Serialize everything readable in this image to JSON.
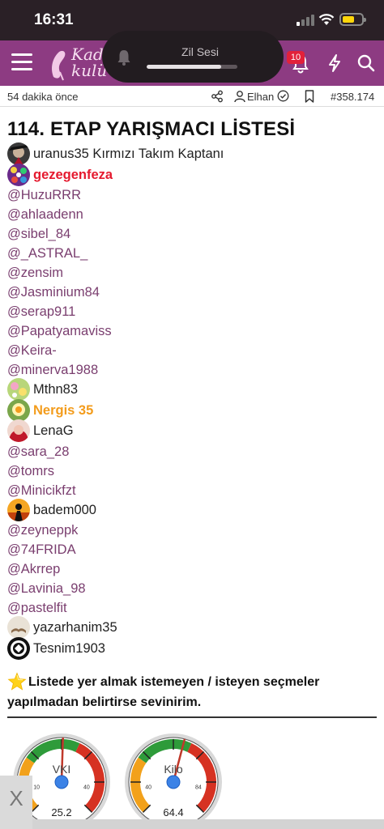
{
  "status": {
    "time": "16:31"
  },
  "island": {
    "label": "Zil Sesi",
    "volume_fraction": 0.82
  },
  "nav": {
    "logo_text": "Kadı\nkulü",
    "notification_count": "10"
  },
  "meta": {
    "time_ago": "54 dakika önce",
    "username": "Elhan",
    "post_number": "#358.174"
  },
  "post": {
    "title": "114. ETAP YARIŞMACI LİSTESİ",
    "entries": [
      {
        "kind": "user",
        "text": "uranus35 Kırmızı Takım Kaptanı",
        "style": "normal",
        "avatar": "dark-hat"
      },
      {
        "kind": "user",
        "text": "gezegenfeza",
        "style": "red",
        "avatar": "colorful-dots"
      },
      {
        "kind": "mention",
        "text": "@HuzuRRR"
      },
      {
        "kind": "mention",
        "text": "@ahlaadenn"
      },
      {
        "kind": "mention",
        "text": "@sibel_84"
      },
      {
        "kind": "mention",
        "text": "@_ASTRAL_"
      },
      {
        "kind": "mention",
        "text": "@zensim"
      },
      {
        "kind": "mention",
        "text": "@Jasminium84"
      },
      {
        "kind": "mention",
        "text": "@serap911"
      },
      {
        "kind": "mention",
        "text": "@Papatyamaviss"
      },
      {
        "kind": "mention",
        "text": "@Keira-"
      },
      {
        "kind": "mention",
        "text": "@minerva1988"
      },
      {
        "kind": "user",
        "text": "Mthn83",
        "style": "normal",
        "avatar": "flowers"
      },
      {
        "kind": "user",
        "text": "Nergis 35",
        "style": "orange",
        "avatar": "daffodil"
      },
      {
        "kind": "user",
        "text": "LenaG",
        "style": "normal",
        "avatar": "red-hair"
      },
      {
        "kind": "mention",
        "text": "@sara_28"
      },
      {
        "kind": "mention",
        "text": "@tomrs"
      },
      {
        "kind": "mention",
        "text": "@Minicikfzt"
      },
      {
        "kind": "user",
        "text": "badem000",
        "style": "normal",
        "avatar": "silhouette"
      },
      {
        "kind": "mention",
        "text": "@zeyneppk"
      },
      {
        "kind": "mention",
        "text": "@74FRIDA"
      },
      {
        "kind": "mention",
        "text": "@Akrrep"
      },
      {
        "kind": "mention",
        "text": "@Lavinia_98"
      },
      {
        "kind": "mention",
        "text": "@pastelfit"
      },
      {
        "kind": "user",
        "text": "yazarhanim35",
        "style": "normal",
        "avatar": "book"
      },
      {
        "kind": "user",
        "text": "Tesnim1903",
        "style": "normal",
        "avatar": "eagle-badge"
      }
    ],
    "notice": "Listede yer almak istemeyen / isteyen seçmeler yapılmadan belirtirse sevinirim."
  },
  "gauges": [
    {
      "label": "VKI",
      "value": "25.2",
      "numeric": 25.2,
      "min": 10,
      "max": 40,
      "ticks": [
        "10",
        "40"
      ]
    },
    {
      "label": "Kilo",
      "value": "64.4",
      "numeric": 64.4,
      "min": 40,
      "max": 84,
      "ticks": [
        "40",
        "84"
      ]
    }
  ],
  "close_label": "X",
  "colors": {
    "nav": "#8d3b82",
    "mention": "#7a3e6f",
    "red_name": "#e5192e",
    "orange_name": "#f39c1c"
  }
}
